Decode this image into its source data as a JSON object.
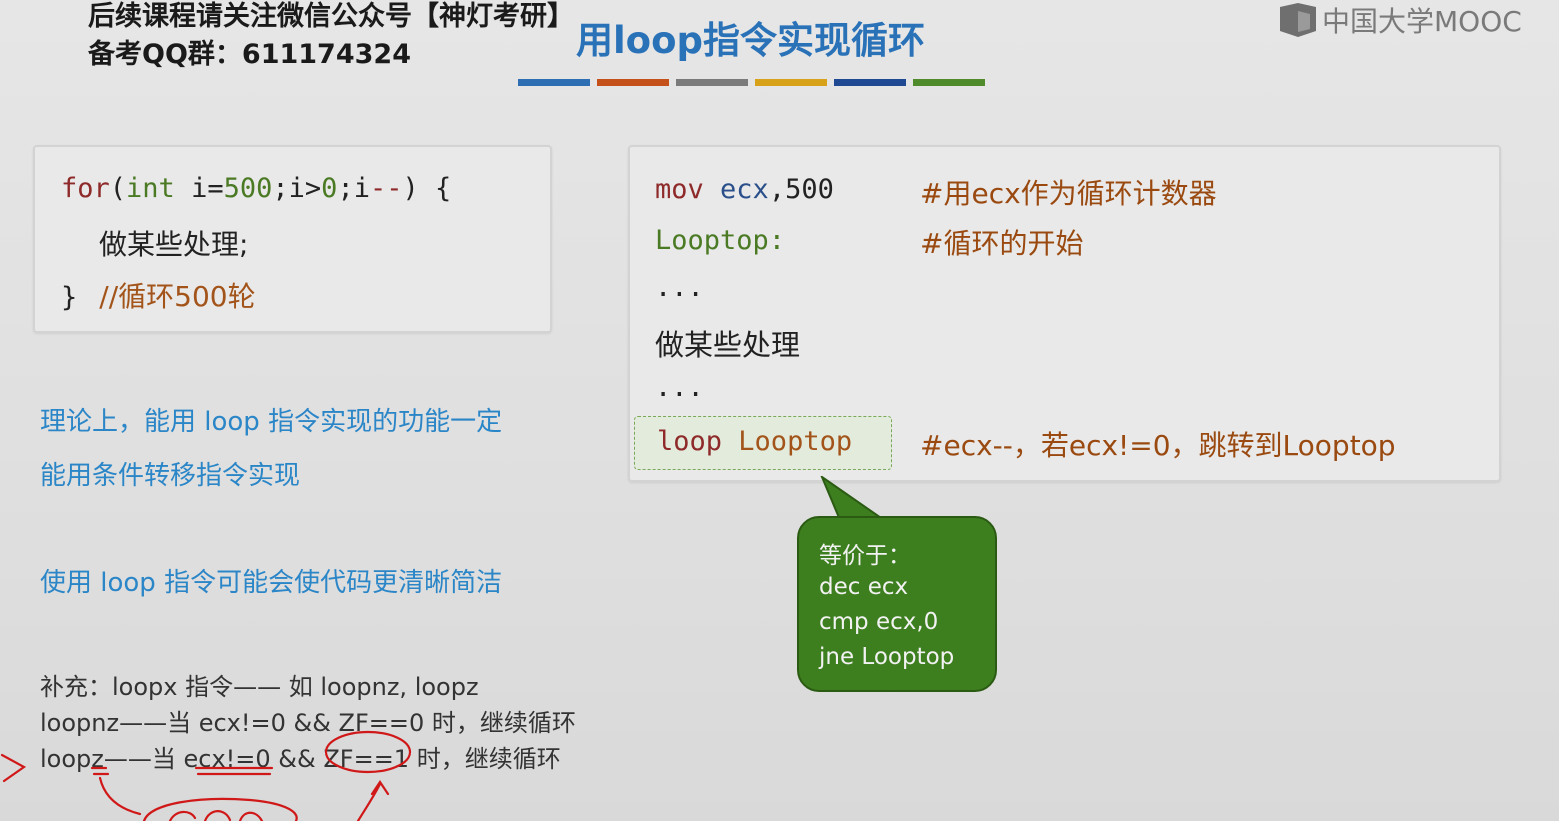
{
  "header": {
    "promo_line1": "后续课程请关注微信公众号【神灯考研】",
    "promo_line2": "备考QQ群：611174324",
    "title": "用loop指令实现循环",
    "logo_text": "中国大学MOOC",
    "title_bar_colors": [
      "#2e6fb4",
      "#c5511a",
      "#7b7b7b",
      "#d7a219",
      "#1f4a93",
      "#4f8a2b"
    ]
  },
  "c_code": {
    "line1": {
      "for": "for",
      "paren_open": "(",
      "int": "int",
      "rest_a": " i=",
      "n500": "500",
      "rest_b": ";i>",
      "n0": "0",
      "rest_c": ";i",
      "minus": "--",
      "close": ") {"
    },
    "line2": "做某些处理;",
    "line3_brace": "}",
    "line3_comment": "//循环500轮"
  },
  "asm_code": {
    "l1_mnemonic": "mov",
    "l1_reg": "ecx",
    "l1_value": ",500",
    "l1_comment": "#用ecx作为循环计数器",
    "l2_label": "Looptop:",
    "l2_comment": "#循环的开始",
    "l3": "...",
    "l4": "做某些处理",
    "l5": "...",
    "l6_mnemonic": "loop",
    "l6_label": "Looptop",
    "l6_comment": "#ecx--，若ecx!=0，跳转到Looptop"
  },
  "callout": {
    "title": "等价于：",
    "line1": "dec ecx",
    "line2": "cmp ecx,0",
    "line3": "jne Looptop"
  },
  "notes": {
    "theory_line1": "理论上，能用 loop 指令实现的功能一定",
    "theory_line2": "能用条件转移指令实现",
    "clarity": "使用 loop 指令可能会使代码更清晰简洁",
    "supp_line1": "补充：loopx 指令—— 如 loopnz, loopz",
    "supp_line2": "loopnz——当 ecx!=0 && ZF==0 时，继续循环",
    "supp_line3": "loopz——当 ecx!=0 && ZF==1 时，继续循环"
  }
}
